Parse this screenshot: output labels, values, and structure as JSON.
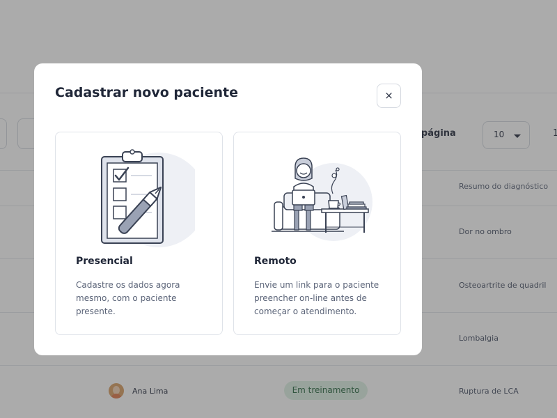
{
  "background": {
    "per_page_label": "r página",
    "per_page_value": "10",
    "page_number": "1",
    "table": {
      "column_header": "Resumo do diagnóstico",
      "rows": [
        "Dor no ombro",
        "Osteoartrite de quadril",
        "Lombalgia",
        "Ruptura de LCA"
      ],
      "last_row_user": "Ana Lima",
      "last_row_status": "Em treinamento"
    }
  },
  "modal": {
    "title": "Cadastrar novo paciente",
    "close_label": "×",
    "options": [
      {
        "title": "Presencial",
        "description": "Cadastre os dados agora mesmo, com o paciente presente.",
        "icon": "clipboard-checklist-illustration"
      },
      {
        "title": "Remoto",
        "description": "Envie um link para o paciente preencher on-line antes de começar o atendimento.",
        "icon": "person-with-laptop-illustration"
      }
    ]
  },
  "colors": {
    "overlay": "#373737",
    "badge_bg": "#dff2e5",
    "badge_text": "#2d6b45",
    "illustration_bg": "#eef0f5",
    "illustration_stroke": "#3a4254"
  }
}
